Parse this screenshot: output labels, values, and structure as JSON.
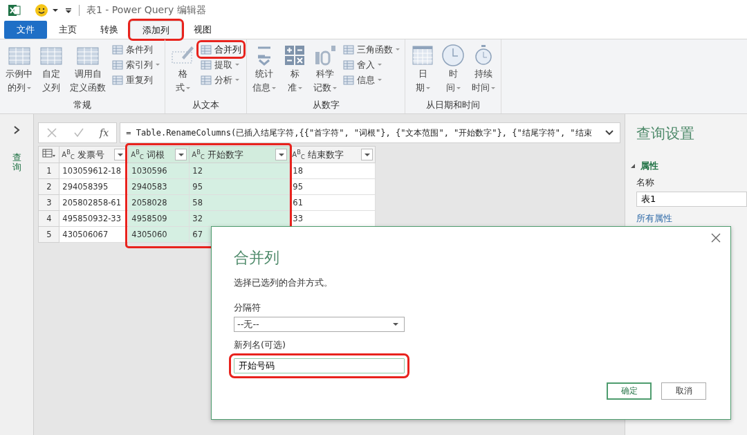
{
  "window": {
    "title": "表1 - Power Query 编辑器"
  },
  "tabs": [
    {
      "label": "文件",
      "kind": "file",
      "selected": false,
      "highlighted": false
    },
    {
      "label": "主页",
      "kind": "tab",
      "selected": false,
      "highlighted": false
    },
    {
      "label": "转换",
      "kind": "tab",
      "selected": false,
      "highlighted": false
    },
    {
      "label": "添加列",
      "kind": "tab",
      "selected": true,
      "highlighted": true
    },
    {
      "label": "视图",
      "kind": "tab",
      "selected": false,
      "highlighted": false
    }
  ],
  "ribbon": {
    "groups": [
      {
        "label": "常规",
        "large": [
          {
            "lines": [
              "示例中",
              "的列"
            ],
            "dropdown": true
          },
          {
            "lines": [
              "自定",
              "义列"
            ],
            "dropdown": false
          },
          {
            "lines": [
              "调用自",
              "定义函数"
            ],
            "dropdown": false
          }
        ],
        "small": [
          {
            "label": "条件列",
            "dropdown": false,
            "highlighted": false
          },
          {
            "label": "索引列",
            "dropdown": true,
            "highlighted": false
          },
          {
            "label": "重复列",
            "dropdown": false,
            "highlighted": false
          }
        ]
      },
      {
        "label": "从文本",
        "large": [
          {
            "lines": [
              "格",
              "式"
            ],
            "dropdown": true
          }
        ],
        "small": [
          {
            "label": "合并列",
            "dropdown": false,
            "highlighted": true
          },
          {
            "label": "提取",
            "dropdown": true,
            "highlighted": false
          },
          {
            "label": "分析",
            "dropdown": true,
            "highlighted": false
          }
        ]
      },
      {
        "label": "从数字",
        "large": [
          {
            "lines": [
              "统计",
              "信息"
            ],
            "dropdown": true
          },
          {
            "lines": [
              "标",
              "准"
            ],
            "dropdown": true
          },
          {
            "lines": [
              "科学",
              "记数"
            ],
            "dropdown": true
          }
        ],
        "small": [
          {
            "label": "三角函数",
            "dropdown": true,
            "highlighted": false
          },
          {
            "label": "舍入",
            "dropdown": true,
            "highlighted": false
          },
          {
            "label": "信息",
            "dropdown": true,
            "highlighted": false
          }
        ]
      },
      {
        "label": "从日期和时间",
        "large": [
          {
            "lines": [
              "日",
              "期"
            ],
            "dropdown": true
          },
          {
            "lines": [
              "时",
              "间"
            ],
            "dropdown": true
          },
          {
            "lines": [
              "持续",
              "时间"
            ],
            "dropdown": true
          }
        ]
      }
    ]
  },
  "sidebar": {
    "label": "查询"
  },
  "formula_bar": {
    "fx": "fx",
    "formula": "= Table.RenameColumns(已插入结尾字符,{{\"首字符\", \"词根\"}, {\"文本范围\", \"开始数字\"}, {\"结尾字符\", \"结束"
  },
  "table": {
    "selection_highlighted": true,
    "columns": [
      {
        "type": "A$^{B}$$_{C}$",
        "name": "发票号",
        "selected": false
      },
      {
        "type": "A$^{B}$$_{C}$",
        "name": "词根",
        "selected": true
      },
      {
        "type": "A$^{B}$$_{C}$",
        "name": "开始数字",
        "selected": true
      },
      {
        "type": "A$^{B}$$_{C}$",
        "name": "结束数字",
        "selected": false
      }
    ],
    "rows": [
      {
        "number": "1",
        "cells": [
          "103059612-18",
          "1030596",
          "12",
          "18"
        ]
      },
      {
        "number": "2",
        "cells": [
          "294058395",
          "2940583",
          "95",
          "95"
        ]
      },
      {
        "number": "3",
        "cells": [
          "205802858-61",
          "2058028",
          "58",
          "61"
        ]
      },
      {
        "number": "4",
        "cells": [
          "495850932-33",
          "4958509",
          "32",
          "33"
        ]
      },
      {
        "number": "5",
        "cells": [
          "430506067",
          "4305060",
          "67"
        ]
      }
    ]
  },
  "query_settings": {
    "title": "查询设置",
    "section": "属性",
    "expanded": true,
    "name_label": "名称",
    "name_value": "表1",
    "link": "所有属性"
  },
  "dialog": {
    "title": "合并列",
    "description": "选择已选列的合并方式。",
    "separator_label": "分隔符",
    "separator_value": "--无--",
    "name_label": "新列名(可选)",
    "name_value": "开始号码",
    "name_highlighted": true,
    "buttons": [
      {
        "label": "确定",
        "kind": "primary"
      },
      {
        "label": "取消",
        "kind": "secondary"
      }
    ]
  }
}
